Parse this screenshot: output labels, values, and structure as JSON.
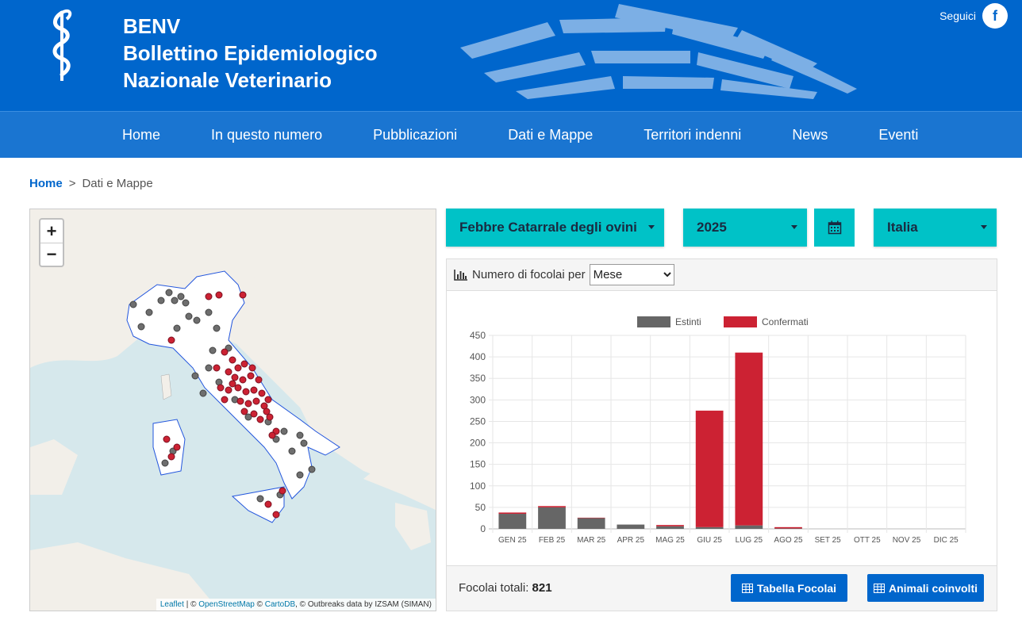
{
  "header": {
    "title_line1": "BENV",
    "title_line2": "Bollettino Epidemiologico",
    "title_line3": "Nazionale Veterinario",
    "social_label": "Seguici",
    "social_icon": "facebook-icon"
  },
  "nav": {
    "items": [
      "Home",
      "In questo numero",
      "Pubblicazioni",
      "Dati e Mappe",
      "Territori indenni",
      "News",
      "Eventi"
    ]
  },
  "breadcrumb": {
    "home": "Home",
    "separator": ">",
    "current": "Dati e Mappe"
  },
  "map": {
    "zoom_in": "+",
    "zoom_out": "−",
    "attribution": {
      "leaflet": "Leaflet",
      "osm": "OpenStreetMap",
      "carto": "CartoDB",
      "rest": ", © Outbreaks data by IZSAM (SIMAN)"
    }
  },
  "filters": {
    "disease": "Febbre Catarrale degli ovini (BT)",
    "year": "2025",
    "area": "Italia",
    "calendar_icon": "calendar-icon"
  },
  "panel": {
    "label": "Numero di focolai per",
    "period_selected": "Mese",
    "period_options": [
      "Mese"
    ],
    "totals_label": "Focolai totali:",
    "totals_value": "821",
    "btn_table": "Tabella Focolai",
    "btn_animals": "Animali coinvolti"
  },
  "colors": {
    "primary": "#0066cc",
    "nav": "#1a75d1",
    "teal": "#00c2c7",
    "estinti": "#666666",
    "confermati": "#cc2233"
  },
  "chart_data": {
    "type": "bar",
    "stacked": true,
    "categories": [
      "GEN 25",
      "FEB 25",
      "MAR 25",
      "APR 25",
      "MAG 25",
      "GIU 25",
      "LUG 25",
      "AGO 25",
      "SET 25",
      "OTT 25",
      "NOV 25",
      "DIC 25"
    ],
    "series": [
      {
        "name": "Estinti",
        "color": "#666666",
        "values": [
          35,
          50,
          25,
          10,
          6,
          4,
          8,
          1,
          0,
          0,
          0,
          0
        ]
      },
      {
        "name": "Confermati",
        "color": "#cc2233",
        "values": [
          3,
          3,
          1,
          0,
          3,
          271,
          402,
          3,
          0,
          0,
          0,
          0
        ]
      }
    ],
    "yticks": [
      0,
      50,
      100,
      150,
      200,
      250,
      300,
      350,
      400,
      450
    ],
    "ylim": [
      0,
      450
    ],
    "legend_position": "top",
    "grid": true
  }
}
